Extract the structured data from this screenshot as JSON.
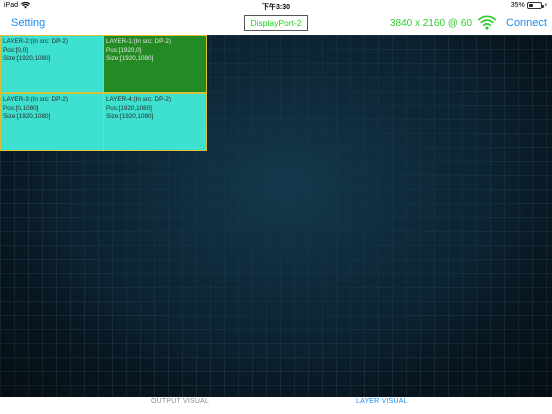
{
  "status_bar": {
    "device": "iPad",
    "time": "下午3:30",
    "battery_text": "35%",
    "battery_level": 0.35
  },
  "nav": {
    "setting_label": "Setting",
    "source_label": "DisplayPort-2",
    "resolution": "3840 x 2160 @ 60",
    "wifi_icon": "wifi-icon",
    "connect_label": "Connect",
    "colors": {
      "link": "#1e8ef0",
      "accent_green": "#2fce2f"
    }
  },
  "layers": [
    {
      "title": "LAYER-2:(In src: DP-2)",
      "pos": "Pos:[0,0]",
      "size": "Size:[1920,1080]",
      "color": "#3ee0cf"
    },
    {
      "title": "LAYER-1:(In src: DP-2)",
      "pos": "Pos:[1920,0]",
      "size": "Size:[1920,1080]",
      "color": "#248a24"
    },
    {
      "title": "LAYER-3:(In src: DP-2)",
      "pos": "Pos:[0,1080]",
      "size": "Size:[1920,1080]",
      "color": "#3ee0cf"
    },
    {
      "title": "LAYER-4:(In src: DP-2)",
      "pos": "Pos:[1920,1080]",
      "size": "Size:[1920,1080]",
      "color": "#3ee0cf"
    }
  ],
  "tabs": {
    "output_label": "OUTPUT VISUAL",
    "layer_label": "LAYER VISUAL",
    "active": "LAYER VISUAL"
  }
}
